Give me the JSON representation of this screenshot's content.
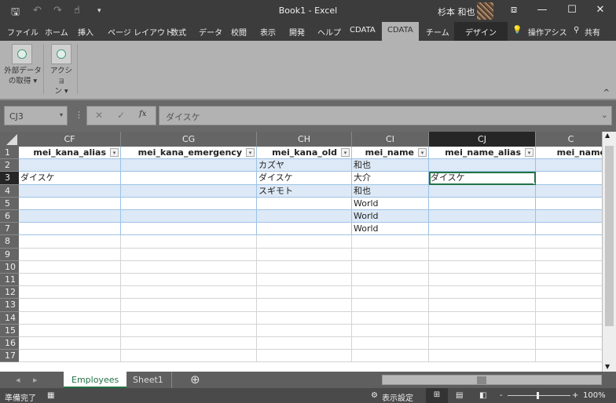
{
  "window": {
    "title": "Book1 - Excel",
    "user": "杉本 和也"
  },
  "quick_access": {
    "save": "🖫",
    "undo": "↶",
    "redo": "↷",
    "touch": "☝",
    "customize": "▾"
  },
  "window_controls": {
    "restore_ribbon": "⧈",
    "minimize": "—",
    "maximize": "☐",
    "close": "✕"
  },
  "tabs": [
    "ファイル",
    "ホーム",
    "挿入",
    "ページ レイアウト",
    "数式",
    "データ",
    "校閲",
    "表示",
    "開発",
    "ヘルプ",
    "CDATA",
    "CDATA",
    "チーム",
    "デザイン"
  ],
  "tell_me": "操作アシス",
  "share": "共有",
  "ribbon": {
    "buttons": [
      {
        "label1": "外部データ",
        "label2": "の取得 ▾"
      },
      {
        "label1": "アクショ",
        "label2": "ン ▾"
      }
    ],
    "collapse": "^"
  },
  "formula_bar": {
    "name_box": "CJ3",
    "cancel": "✕",
    "enter": "✓",
    "fx": "fx",
    "value": "ダイスケ",
    "expand": "⌄"
  },
  "columns": [
    "CF",
    "CG",
    "CH",
    "CI",
    "CJ",
    "C"
  ],
  "headers": [
    "mei_kana_alias",
    "mei_kana_emergency",
    "mei_kana_old",
    "mei_name",
    "mei_name_alias",
    "mei_name"
  ],
  "rows": [
    [
      "",
      "",
      "カズヤ",
      "和也",
      "",
      ""
    ],
    [
      "ダイスケ",
      "",
      "ダイスケ",
      "大介",
      "ダイスケ",
      ""
    ],
    [
      "",
      "",
      "スギモト",
      "和也",
      "",
      ""
    ],
    [
      "",
      "",
      "",
      "World",
      "",
      ""
    ],
    [
      "",
      "",
      "",
      "World",
      "",
      ""
    ],
    [
      "",
      "",
      "",
      "World",
      "",
      ""
    ]
  ],
  "row_numbers": [
    "1",
    "2",
    "3",
    "4",
    "5",
    "6",
    "7",
    "8",
    "9",
    "10",
    "11",
    "12",
    "13",
    "14",
    "15",
    "16",
    "17"
  ],
  "sheets": {
    "nav_prev": "◂",
    "nav_next": "▸",
    "tabs": [
      "Employees",
      "Sheet1"
    ],
    "add": "⊕"
  },
  "status": {
    "ready": "準備完了",
    "display_settings": "表示設定",
    "zoom": "100%",
    "zoom_minus": "-",
    "zoom_plus": "+"
  }
}
